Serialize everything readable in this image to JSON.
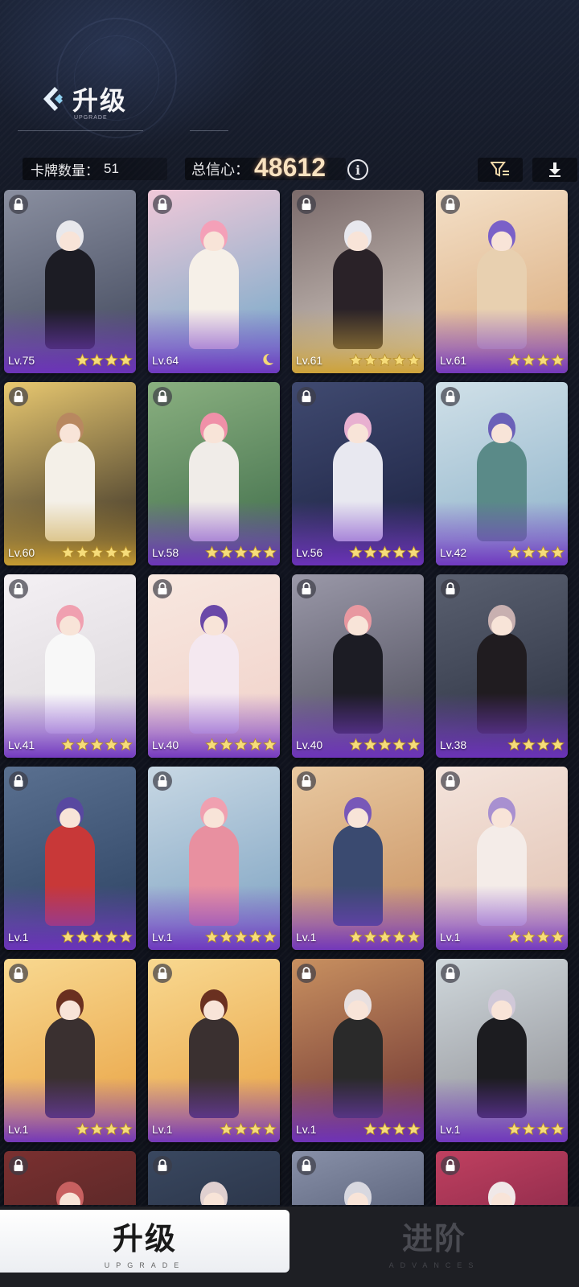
{
  "header": {
    "title": "升级",
    "subtitle": "UPGRADE",
    "card_count_label": "卡牌数量：",
    "card_count_value": "51",
    "confidence_label": "总信心：",
    "confidence_value": "48612"
  },
  "toolbar": {
    "filter_icon": "filter-icon",
    "sort_icon": "download-sort-icon",
    "info_icon": "info-icon",
    "info_glyph": "i"
  },
  "cards": [
    {
      "level": "Lv.75",
      "stars": 4,
      "rarity": "purple",
      "bg1": "#3d4458",
      "bg2": "#8a8fa0",
      "hair": "#e8e8ec",
      "outfit": "#1c1c24"
    },
    {
      "level": "Lv.64",
      "stars": 0,
      "moon": true,
      "rarity": "purple",
      "bg1": "#6aa7c8",
      "bg2": "#f0c8d8",
      "hair": "#f4a0b8",
      "outfit": "#f6f0e8"
    },
    {
      "level": "Lv.61",
      "stars": 5,
      "rarity": "gold",
      "bg1": "#d8d0c8",
      "bg2": "#7a6a6a",
      "hair": "#e8e8ee",
      "outfit": "#2a2228"
    },
    {
      "level": "Lv.61",
      "stars": 4,
      "rarity": "purple",
      "bg1": "#d8a878",
      "bg2": "#f4e0c8",
      "hair": "#7a60c8",
      "outfit": "#e8d0b0"
    },
    {
      "level": "Lv.60",
      "stars": 5,
      "rarity": "gold",
      "bg1": "#2a2420",
      "bg2": "#e8c870",
      "hair": "#b88860",
      "outfit": "#f4f0e8"
    },
    {
      "level": "Lv.58",
      "stars": 5,
      "rarity": "purple",
      "bg1": "#3c6a48",
      "bg2": "#8ab080",
      "hair": "#f090a8",
      "outfit": "#f0ece8"
    },
    {
      "level": "Lv.56",
      "stars": 5,
      "rarity": "purple",
      "bg1": "#1a2040",
      "bg2": "#404a70",
      "hair": "#e8b0d0",
      "outfit": "#e8e8f0"
    },
    {
      "level": "Lv.42",
      "stars": 4,
      "rarity": "purple",
      "bg1": "#8ab0c8",
      "bg2": "#d0e0e8",
      "hair": "#6a60b8",
      "outfit": "#5a8a88"
    },
    {
      "level": "Lv.41",
      "stars": 5,
      "rarity": "purple",
      "bg1": "#d8d4d8",
      "bg2": "#f4f0f4",
      "hair": "#f0a0b0",
      "outfit": "#f8f8f8"
    },
    {
      "level": "Lv.40",
      "stars": 5,
      "rarity": "purple",
      "bg1": "#f0d0c8",
      "bg2": "#f8e8e0",
      "hair": "#6a48a8",
      "outfit": "#f4e8f0"
    },
    {
      "level": "Lv.40",
      "stars": 5,
      "rarity": "purple",
      "bg1": "#4a4a58",
      "bg2": "#9a98a8",
      "hair": "#e898a0",
      "outfit": "#1c1c24"
    },
    {
      "level": "Lv.38",
      "stars": 4,
      "rarity": "purple",
      "bg1": "#2a3040",
      "bg2": "#5a6070",
      "hair": "#c8b0b0",
      "outfit": "#201c20"
    },
    {
      "level": "Lv.1",
      "stars": 5,
      "rarity": "purple",
      "bg1": "#2a4060",
      "bg2": "#5a7090",
      "hair": "#5848a0",
      "outfit": "#c83838"
    },
    {
      "level": "Lv.1",
      "stars": 5,
      "rarity": "purple",
      "bg1": "#7aa0c0",
      "bg2": "#c8d8e4",
      "hair": "#f0a0b0",
      "outfit": "#e890a0"
    },
    {
      "level": "Lv.1",
      "stars": 5,
      "rarity": "purple",
      "bg1": "#c89060",
      "bg2": "#e8c8a0",
      "hair": "#7858b8",
      "outfit": "#3a4a70"
    },
    {
      "level": "Lv.1",
      "stars": 4,
      "rarity": "purple",
      "bg1": "#e0c0b0",
      "bg2": "#f4e4dc",
      "hair": "#a890d0",
      "outfit": "#f4ece8"
    },
    {
      "level": "Lv.1",
      "stars": 4,
      "rarity": "purple",
      "bg1": "#e8a040",
      "bg2": "#f8d890",
      "hair": "#6a3020",
      "outfit": "#3a3030"
    },
    {
      "level": "Lv.1",
      "stars": 4,
      "rarity": "purple",
      "bg1": "#e8a040",
      "bg2": "#f8d890",
      "hair": "#6a3020",
      "outfit": "#3a3030"
    },
    {
      "level": "Lv.1",
      "stars": 4,
      "rarity": "purple",
      "bg1": "#6a3030",
      "bg2": "#c89060",
      "hair": "#e8e0e0",
      "outfit": "#2a2a2a"
    },
    {
      "level": "Lv.1",
      "stars": 4,
      "rarity": "purple",
      "bg1": "#8a8a90",
      "bg2": "#d0d8dc",
      "hair": "#d0c8d8",
      "outfit": "#1c1c20"
    },
    {
      "level": "",
      "stars": 0,
      "rarity": "purple",
      "bg1": "#3a2020",
      "bg2": "#7a3030",
      "hair": "#c86060",
      "outfit": "#2a1818"
    },
    {
      "level": "",
      "stars": 0,
      "rarity": "purple",
      "bg1": "#1a2030",
      "bg2": "#3a4860",
      "hair": "#e0d0d0",
      "outfit": "#2a2a3a"
    },
    {
      "level": "",
      "stars": 0,
      "rarity": "purple",
      "bg1": "#303850",
      "bg2": "#8890a8",
      "hair": "#d8d8e0",
      "outfit": "#2a2a30"
    },
    {
      "level": "",
      "stars": 0,
      "rarity": "purple",
      "bg1": "#601838",
      "bg2": "#c04060",
      "hair": "#f0e8e8",
      "outfit": "#2a1018"
    }
  ],
  "tabs": {
    "upgrade_label": "升级",
    "upgrade_sub": "UPGRADE",
    "advances_label": "进阶",
    "advances_sub": "ADVANCES"
  }
}
